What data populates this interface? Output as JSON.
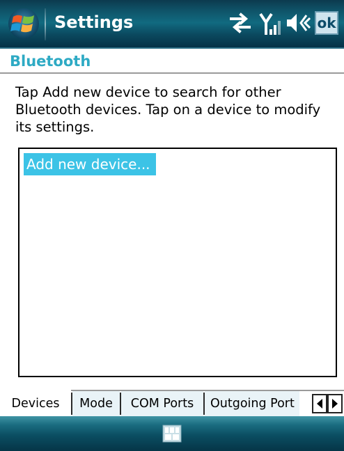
{
  "titlebar": {
    "title": "Settings",
    "ok_label": "ok",
    "icons": [
      "windows-start-icon",
      "connectivity-icon",
      "signal-icon",
      "speaker-icon"
    ]
  },
  "header": {
    "title": "Bluetooth"
  },
  "instructions": "Tap Add new device to search for other Bluetooth devices. Tap on a device to modify its settings.",
  "device_list": {
    "items": [
      {
        "label": "Add new device...",
        "selected": true
      }
    ]
  },
  "tabs": [
    {
      "label": "Devices",
      "active": true
    },
    {
      "label": "Mode",
      "active": false
    },
    {
      "label": "COM Ports",
      "active": false
    },
    {
      "label": "Outgoing Port",
      "active": false
    }
  ],
  "softbar": {
    "icon": "keyboard-icon"
  },
  "colors": {
    "accent": "#2eaac4",
    "selection": "#3cc3e6",
    "titlebar": "#116a80",
    "ok_button": "#cfe4ee"
  }
}
